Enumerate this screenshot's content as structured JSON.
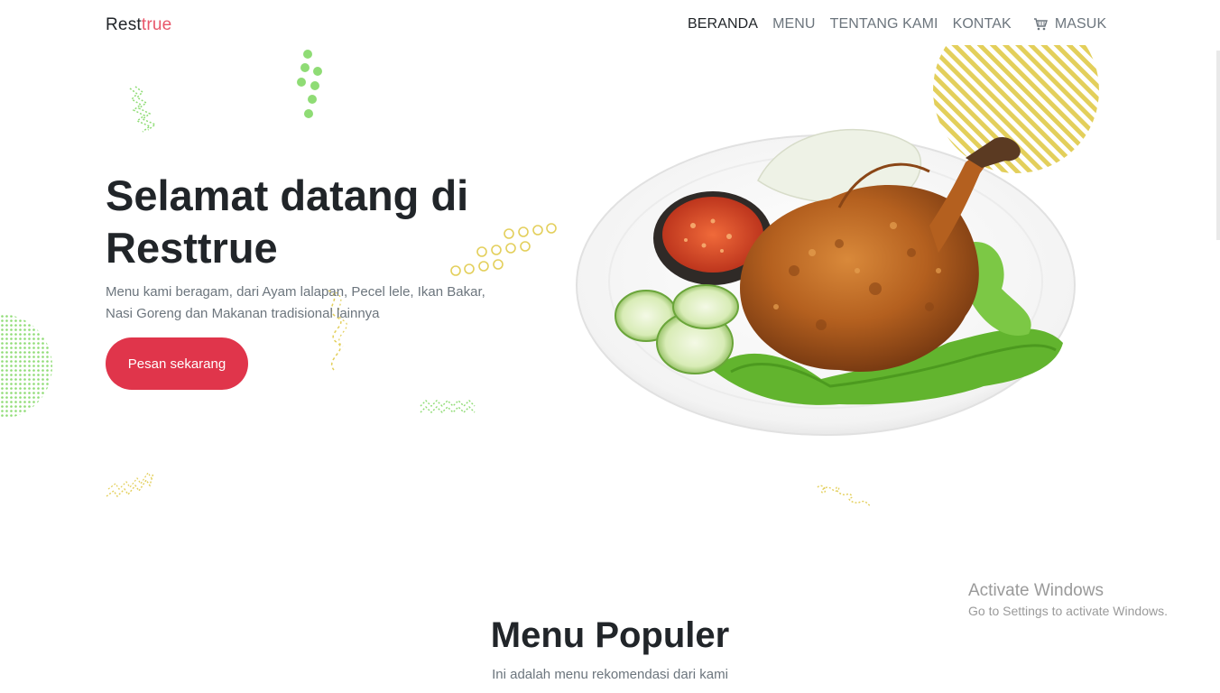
{
  "brand": {
    "name_part1": "Rest",
    "name_part2": "true"
  },
  "nav": {
    "items": [
      {
        "label": "BERANDA"
      },
      {
        "label": "MENU"
      },
      {
        "label": "TENTANG KAMI"
      },
      {
        "label": "KONTAK"
      }
    ],
    "login_label": "MASUK",
    "login_icon": "cart-icon"
  },
  "hero": {
    "title": "Selamat datang di Resttrue",
    "description": "Menu kami beragam, dari Ayam lalapan, Pecel lele, Ikan Bakar, Nasi Goreng dan Makanan tradisional lainnya",
    "cta_label": "Pesan sekarang"
  },
  "popular": {
    "title": "Menu Populer",
    "subtitle": "Ini adalah menu rekomendasi dari kami"
  },
  "watermark": {
    "line1": "Activate Windows",
    "line2": "Go to Settings to activate Windows."
  },
  "colors": {
    "accent": "#e0354b",
    "brand_accent": "#e8566a",
    "deco_green": "#8fdc75",
    "deco_yellow": "#e3cf5b"
  }
}
